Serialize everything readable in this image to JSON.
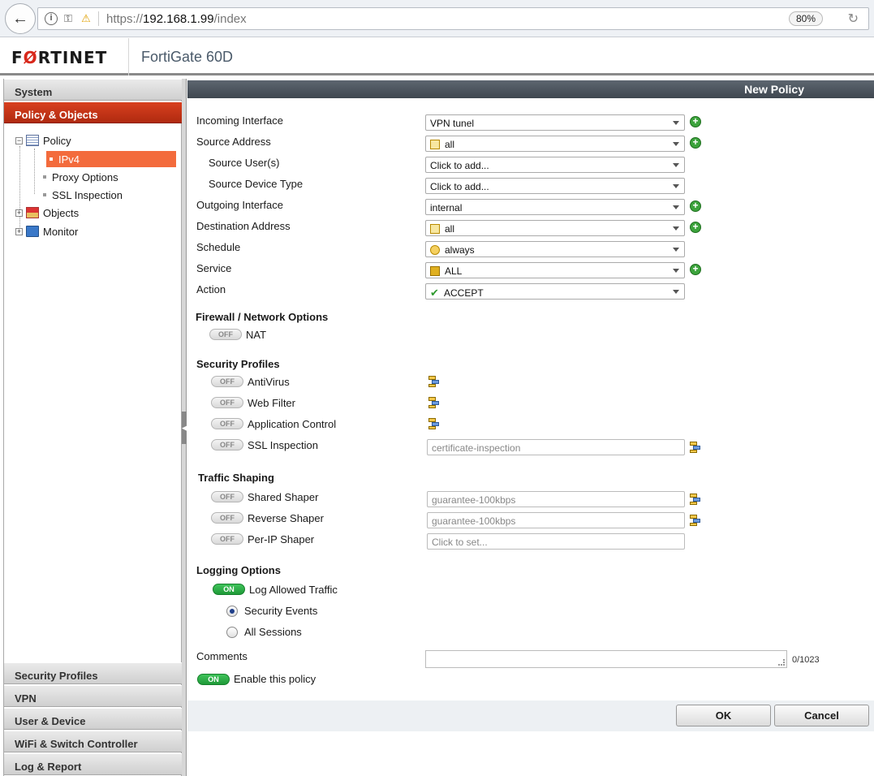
{
  "browser": {
    "url_prefix": "https://",
    "url_host": "192.168.1.99",
    "url_path": "/index",
    "zoom": "80%"
  },
  "app": {
    "logo_text_pre": "F",
    "logo_text_o": "Ø",
    "logo_text_post": "RTINET",
    "device": "FortiGate 60D"
  },
  "sidebar": {
    "sections_top": [
      {
        "label": "System"
      },
      {
        "label": "Policy & Objects"
      }
    ],
    "tree": {
      "policy": "Policy",
      "ipv4": "IPv4",
      "proxy_options": "Proxy Options",
      "ssl_inspection": "SSL Inspection",
      "objects": "Objects",
      "monitor": "Monitor"
    },
    "sections_bottom": [
      {
        "label": "Security Profiles"
      },
      {
        "label": "VPN"
      },
      {
        "label": "User & Device"
      },
      {
        "label": "WiFi & Switch Controller"
      },
      {
        "label": "Log & Report"
      }
    ]
  },
  "main": {
    "title": "New Policy",
    "fields": {
      "incoming_interface": {
        "label": "Incoming Interface",
        "value": "VPN tunel"
      },
      "source_address": {
        "label": "Source Address",
        "value": "all"
      },
      "source_users": {
        "label": "Source User(s)",
        "value": "Click to add..."
      },
      "source_device_type": {
        "label": "Source Device Type",
        "value": "Click to add..."
      },
      "outgoing_interface": {
        "label": "Outgoing Interface",
        "value": "internal"
      },
      "destination_address": {
        "label": "Destination Address",
        "value": "all"
      },
      "schedule": {
        "label": "Schedule",
        "value": "always"
      },
      "service": {
        "label": "Service",
        "value": "ALL"
      },
      "action": {
        "label": "Action",
        "value": "ACCEPT"
      }
    },
    "firewall": {
      "title": "Firewall / Network Options",
      "nat": {
        "label": "NAT",
        "state": "OFF"
      }
    },
    "security_profiles": {
      "title": "Security Profiles",
      "antivirus": {
        "label": "AntiVirus",
        "state": "OFF"
      },
      "web_filter": {
        "label": "Web Filter",
        "state": "OFF"
      },
      "app_control": {
        "label": "Application Control",
        "state": "OFF"
      },
      "ssl_inspection": {
        "label": "SSL Inspection",
        "state": "OFF",
        "value": "certificate-inspection"
      }
    },
    "traffic_shaping": {
      "title": "Traffic Shaping",
      "shared": {
        "label": "Shared Shaper",
        "state": "OFF",
        "value": "guarantee-100kbps"
      },
      "reverse": {
        "label": "Reverse Shaper",
        "state": "OFF",
        "value": "guarantee-100kbps"
      },
      "per_ip": {
        "label": "Per-IP Shaper",
        "state": "OFF",
        "placeholder": "Click to set..."
      }
    },
    "logging": {
      "title": "Logging Options",
      "log_allowed": {
        "label": "Log Allowed Traffic",
        "state": "ON"
      },
      "security_events": "Security Events",
      "all_sessions": "All Sessions"
    },
    "comments": {
      "label": "Comments",
      "counter": "0/1023"
    },
    "enable_policy": {
      "label": "Enable this policy",
      "state": "ON"
    },
    "ok_label": "OK",
    "cancel_label": "Cancel"
  }
}
